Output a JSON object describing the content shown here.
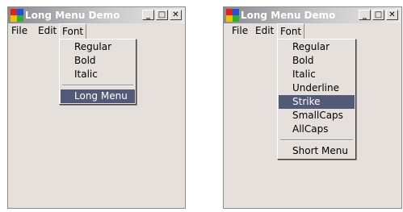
{
  "windows": [
    {
      "title": "Long Menu Demo",
      "menubar": [
        "File",
        "Edit",
        "Font"
      ],
      "open_menu": "Font",
      "dropdown": {
        "items": [
          "Regular",
          "Bold",
          "Italic"
        ],
        "after_separator": "Long Menu",
        "highlighted": "Long Menu"
      }
    },
    {
      "title": "Long Menu Demo",
      "menubar": [
        "File",
        "Edit",
        "Font"
      ],
      "open_menu": "Font",
      "dropdown": {
        "items": [
          "Regular",
          "Bold",
          "Italic",
          "Underline",
          "Strike",
          "SmallCaps",
          "AllCaps"
        ],
        "after_separator": "Short Menu",
        "highlighted": "Strike"
      }
    }
  ],
  "caption_buttons": {
    "minimize": "_",
    "maximize": "□",
    "close": "✕"
  },
  "colors": {
    "highlight": "#535a78",
    "window_face": "#e6e0dc"
  },
  "icons": [
    "app-icon",
    "minimize-icon",
    "maximize-icon",
    "close-icon"
  ]
}
